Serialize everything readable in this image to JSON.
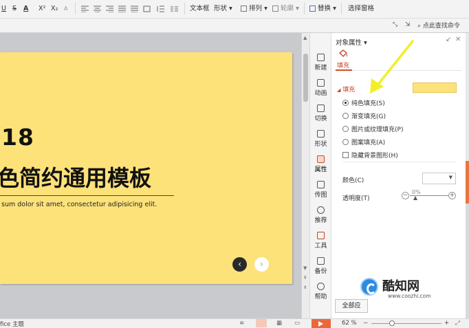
{
  "ribbon": {
    "items": [
      "U",
      "S",
      "A",
      "X²",
      "X₂",
      "A",
      "文本框",
      "形状",
      "排列",
      "轮廓",
      "替换",
      "选择窗格"
    ],
    "search_label": "点此查找命令"
  },
  "slide": {
    "year": "18",
    "title": "色简约通用模板",
    "subtitle": "sum dolor sit amet, consectetur adipisicing elit.",
    "nav_prev": "‹",
    "nav_next": "›",
    "background_color": "#fde27a"
  },
  "sidebar": {
    "items": [
      {
        "label": "新建",
        "icon": "new-icon"
      },
      {
        "label": "动画",
        "icon": "animation-icon"
      },
      {
        "label": "切换",
        "icon": "transition-icon"
      },
      {
        "label": "形状",
        "icon": "shape-icon"
      },
      {
        "label": "属性",
        "icon": "properties-icon",
        "active": true
      },
      {
        "label": "传图",
        "icon": "upload-image-icon"
      },
      {
        "label": "推荐",
        "icon": "recommend-icon"
      },
      {
        "label": "工具",
        "icon": "toolbox-icon"
      },
      {
        "label": "备份",
        "icon": "backup-icon"
      },
      {
        "label": "帮助",
        "icon": "help-icon"
      }
    ]
  },
  "panel": {
    "title": "对象属性 ▾",
    "tab": "填充",
    "section": "填充",
    "fill_color": "#fde27a",
    "options": [
      {
        "label": "纯色填充(S)",
        "type": "radio",
        "checked": true
      },
      {
        "label": "渐变填充(G)",
        "type": "radio",
        "checked": false
      },
      {
        "label": "图片或纹理填充(P)",
        "type": "radio",
        "checked": false
      },
      {
        "label": "图案填充(A)",
        "type": "radio",
        "checked": false
      },
      {
        "label": "隐藏背景图形(H)",
        "type": "checkbox",
        "checked": false
      }
    ],
    "color_label": "颜色(C)",
    "transparency_label": "透明度(T)",
    "transparency_value": "0%",
    "apply_all": "全部应"
  },
  "status": {
    "theme": "fice 主题",
    "zoom": "62 %",
    "minus": "−",
    "plus": "+"
  },
  "watermark": {
    "name": "酷知网",
    "url": "www.coozhi.com"
  },
  "colors": {
    "accent": "#d2461e",
    "slide_yellow": "#fde27a",
    "arrow_yellow": "#f3ee2a"
  }
}
